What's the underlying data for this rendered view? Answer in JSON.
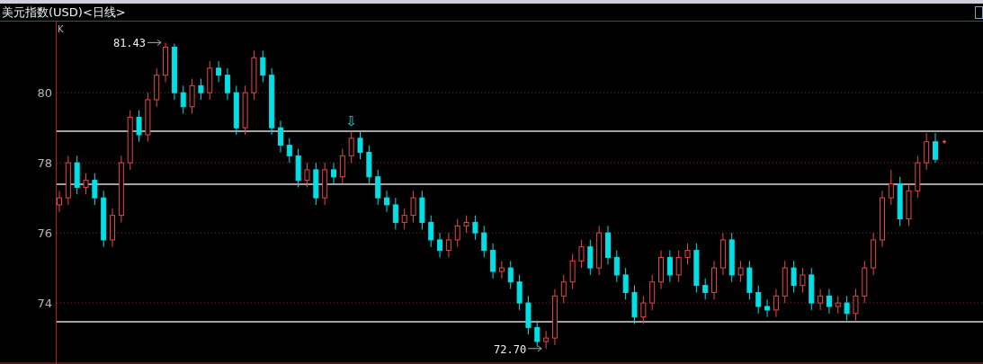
{
  "window": {
    "title": "美元指数(USD)<日线>"
  },
  "chart": {
    "indicator": "K",
    "chart_data": {
      "type": "candlestick",
      "ylim": [
        72.31,
        82.03
      ],
      "yticks": [
        74,
        76,
        78,
        80
      ],
      "grid": true,
      "ohlc": [
        [
          76.8,
          77.2,
          76.6,
          77.0
        ],
        [
          77.0,
          78.2,
          76.8,
          78.0
        ],
        [
          78.0,
          78.2,
          77.1,
          77.3
        ],
        [
          77.3,
          77.7,
          77.1,
          77.5
        ],
        [
          77.5,
          77.7,
          76.8,
          77.0
        ],
        [
          77.0,
          77.2,
          75.6,
          75.8
        ],
        [
          75.8,
          76.7,
          75.6,
          76.5
        ],
        [
          76.5,
          78.2,
          76.3,
          78.0
        ],
        [
          78.0,
          79.5,
          77.8,
          79.3
        ],
        [
          79.3,
          79.5,
          78.6,
          78.8
        ],
        [
          78.8,
          80.0,
          78.6,
          79.8
        ],
        [
          79.8,
          80.7,
          79.6,
          80.5
        ],
        [
          80.5,
          81.43,
          80.3,
          81.3
        ],
        [
          81.3,
          81.4,
          79.8,
          80.0
        ],
        [
          80.0,
          80.2,
          79.4,
          79.6
        ],
        [
          79.6,
          80.4,
          79.4,
          80.2
        ],
        [
          80.2,
          80.4,
          79.8,
          80.0
        ],
        [
          80.0,
          80.9,
          79.8,
          80.7
        ],
        [
          80.7,
          80.9,
          80.3,
          80.5
        ],
        [
          80.5,
          80.7,
          79.8,
          80.0
        ],
        [
          80.0,
          80.2,
          78.8,
          79.0
        ],
        [
          79.0,
          80.2,
          78.8,
          80.0
        ],
        [
          80.0,
          81.2,
          79.8,
          81.0
        ],
        [
          81.0,
          81.2,
          80.3,
          80.5
        ],
        [
          80.5,
          80.7,
          78.8,
          79.0
        ],
        [
          79.0,
          79.2,
          78.3,
          78.5
        ],
        [
          78.5,
          78.7,
          78.0,
          78.2
        ],
        [
          78.2,
          78.4,
          77.3,
          77.5
        ],
        [
          77.5,
          78.0,
          77.3,
          77.8
        ],
        [
          77.8,
          78.0,
          76.8,
          77.0
        ],
        [
          77.0,
          78.0,
          76.8,
          77.8
        ],
        [
          77.8,
          78.0,
          77.4,
          77.6
        ],
        [
          77.6,
          78.4,
          77.4,
          78.2
        ],
        [
          78.2,
          78.9,
          78.0,
          78.7
        ],
        [
          78.7,
          78.9,
          78.1,
          78.3
        ],
        [
          78.3,
          78.5,
          77.4,
          77.6
        ],
        [
          77.6,
          77.8,
          76.8,
          77.0
        ],
        [
          77.0,
          77.2,
          76.6,
          76.8
        ],
        [
          76.8,
          77.0,
          76.1,
          76.3
        ],
        [
          76.3,
          76.7,
          76.1,
          76.5
        ],
        [
          76.5,
          77.2,
          76.3,
          77.0
        ],
        [
          77.0,
          77.2,
          76.1,
          76.3
        ],
        [
          76.3,
          76.5,
          75.6,
          75.8
        ],
        [
          75.8,
          76.0,
          75.3,
          75.5
        ],
        [
          75.5,
          76.0,
          75.3,
          75.8
        ],
        [
          75.8,
          76.4,
          75.6,
          76.2
        ],
        [
          76.2,
          76.5,
          76.0,
          76.3
        ],
        [
          76.3,
          76.5,
          75.8,
          76.0
        ],
        [
          76.0,
          76.2,
          75.3,
          75.5
        ],
        [
          75.5,
          75.7,
          74.7,
          74.9
        ],
        [
          74.9,
          75.2,
          74.7,
          75.0
        ],
        [
          75.0,
          75.2,
          74.4,
          74.6
        ],
        [
          74.6,
          74.8,
          73.8,
          74.0
        ],
        [
          74.0,
          74.2,
          73.1,
          73.3
        ],
        [
          73.3,
          73.5,
          72.75,
          72.9
        ],
        [
          72.9,
          73.2,
          72.7,
          73.0
        ],
        [
          73.0,
          74.4,
          72.8,
          74.2
        ],
        [
          74.2,
          74.8,
          74.0,
          74.6
        ],
        [
          74.6,
          75.4,
          74.4,
          75.2
        ],
        [
          75.2,
          75.8,
          75.0,
          75.6
        ],
        [
          75.6,
          75.8,
          74.8,
          75.0
        ],
        [
          75.0,
          76.2,
          74.8,
          76.0
        ],
        [
          76.0,
          76.2,
          75.1,
          75.3
        ],
        [
          75.3,
          75.5,
          74.6,
          74.8
        ],
        [
          74.8,
          75.0,
          74.1,
          74.3
        ],
        [
          74.3,
          74.5,
          73.4,
          73.6
        ],
        [
          73.6,
          74.2,
          73.4,
          74.0
        ],
        [
          74.0,
          74.8,
          73.8,
          74.6
        ],
        [
          74.6,
          75.5,
          74.4,
          75.3
        ],
        [
          75.3,
          75.5,
          74.6,
          74.8
        ],
        [
          74.8,
          75.5,
          74.6,
          75.3
        ],
        [
          75.3,
          75.7,
          75.1,
          75.5
        ],
        [
          75.5,
          75.7,
          74.3,
          74.5
        ],
        [
          74.5,
          74.7,
          74.1,
          74.3
        ],
        [
          74.3,
          75.2,
          74.1,
          75.0
        ],
        [
          75.0,
          76.0,
          74.8,
          75.8
        ],
        [
          75.8,
          76.0,
          74.6,
          74.8
        ],
        [
          74.8,
          75.2,
          74.6,
          75.0
        ],
        [
          75.0,
          75.2,
          74.1,
          74.3
        ],
        [
          74.3,
          74.5,
          73.7,
          73.9
        ],
        [
          73.9,
          74.1,
          73.6,
          73.8
        ],
        [
          73.8,
          74.4,
          73.6,
          74.2
        ],
        [
          74.2,
          75.2,
          74.0,
          75.0
        ],
        [
          75.0,
          75.2,
          74.3,
          74.5
        ],
        [
          74.5,
          75.0,
          74.3,
          74.8
        ],
        [
          74.8,
          75.0,
          73.8,
          74.0
        ],
        [
          74.0,
          74.4,
          73.8,
          74.2
        ],
        [
          74.2,
          74.4,
          73.7,
          73.9
        ],
        [
          73.9,
          74.2,
          73.7,
          74.0
        ],
        [
          74.0,
          74.2,
          73.5,
          73.7
        ],
        [
          73.7,
          74.4,
          73.5,
          74.2
        ],
        [
          74.2,
          75.2,
          74.0,
          75.0
        ],
        [
          75.0,
          76.0,
          74.8,
          75.8
        ],
        [
          75.8,
          77.2,
          75.6,
          77.0
        ],
        [
          77.0,
          77.8,
          76.8,
          77.4
        ],
        [
          77.4,
          77.6,
          76.2,
          76.4
        ],
        [
          76.4,
          77.4,
          76.2,
          77.2
        ],
        [
          77.2,
          78.2,
          77.0,
          78.0
        ],
        [
          78.0,
          78.85,
          77.8,
          78.6
        ],
        [
          78.6,
          78.85,
          78.0,
          78.1
        ]
      ],
      "annotations": [
        {
          "text": "81.43"
        },
        {
          "text": "⇩"
        },
        {
          "text": "72.70"
        }
      ]
    }
  }
}
